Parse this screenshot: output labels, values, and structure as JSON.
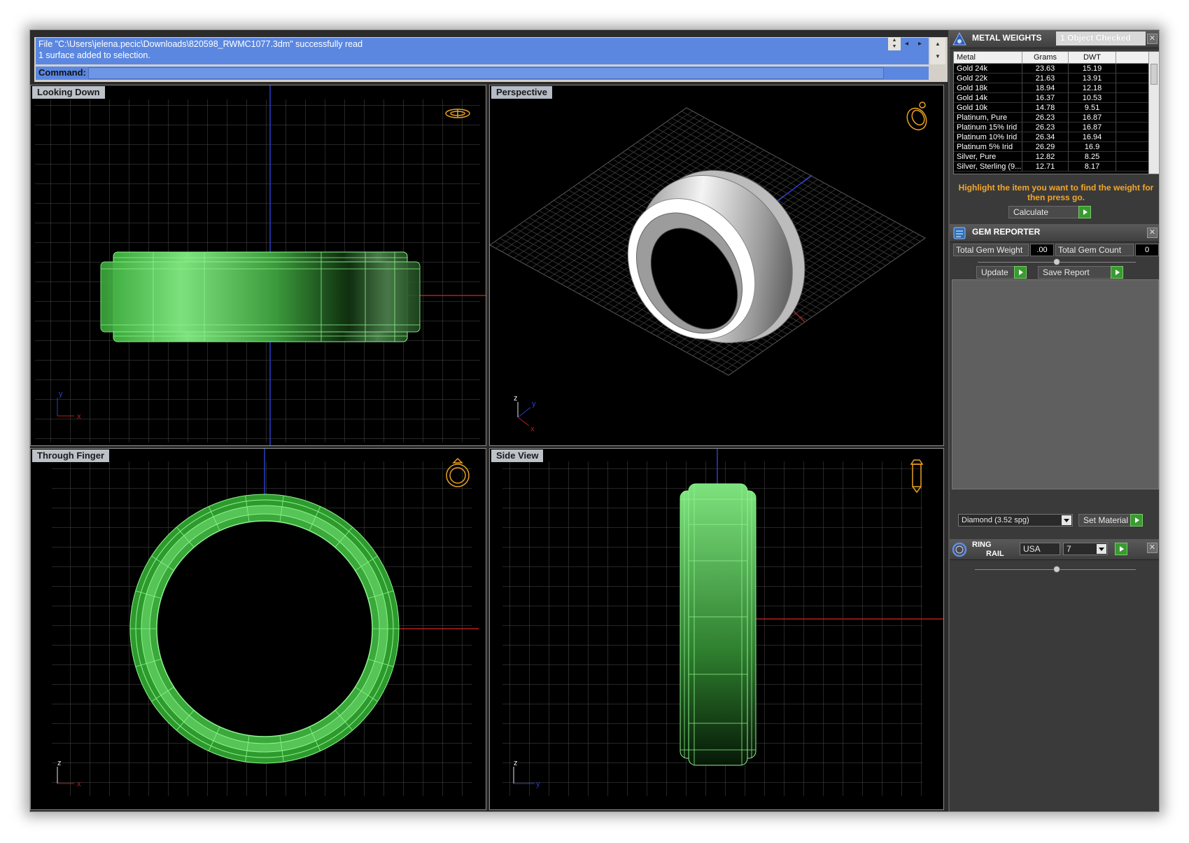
{
  "command": {
    "history_line1": "File \"C:\\Users\\jelena.pecic\\Downloads\\820598_RWMC1077.3dm\" successfully read",
    "history_line2": "1 surface added to selection.",
    "prompt_label": "Command:",
    "input_value": ""
  },
  "viewports": {
    "looking_down": "Looking Down",
    "perspective": "Perspective",
    "through_finger": "Through Finger",
    "side_view": "Side View"
  },
  "axes": {
    "x": "x",
    "y": "y",
    "z": "z"
  },
  "metal_weights": {
    "title": "METAL WEIGHTS",
    "status": "1 Object Checked",
    "columns": [
      "Metal",
      "Grams",
      "DWT"
    ],
    "rows": [
      [
        "Gold 24k",
        "23.63",
        "15.19"
      ],
      [
        "Gold 22k",
        "21.63",
        "13.91"
      ],
      [
        "Gold 18k",
        "18.94",
        "12.18"
      ],
      [
        "Gold 14k",
        "16.37",
        "10.53"
      ],
      [
        "Gold 10k",
        "14.78",
        "9.51"
      ],
      [
        "Platinum, Pure",
        "26.23",
        "16.87"
      ],
      [
        "Platinum 15% Irid",
        "26.23",
        "16.87"
      ],
      [
        "Platinum 10% Irid",
        "26.34",
        "16.94"
      ],
      [
        "Platinum 5% Irid",
        "26.29",
        "16.9"
      ],
      [
        "Silver, Pure",
        "12.82",
        "8.25"
      ],
      [
        "Silver, Sterling (9...",
        "12.71",
        "8.17"
      ]
    ],
    "instructions": "Highlight the item you want to find the weight for then press go.",
    "calculate_label": "Calculate"
  },
  "gem_reporter": {
    "title": "GEM REPORTER",
    "total_weight_label": "Total Gem Weight",
    "total_weight_value": ".00",
    "total_count_label": "Total Gem Count",
    "total_count_value": "0",
    "update_label": "Update",
    "save_report_label": "Save Report",
    "material_value": "Diamond    (3.52 spg)",
    "set_material_label": "Set Material"
  },
  "ring_rail": {
    "title_line1": "RING",
    "title_line2": "RAIL",
    "region_value": "USA",
    "size_value": "7"
  },
  "colors": {
    "command_bg": "#5b87e0",
    "ring_wire": "#7cf07c",
    "instructions_text": "#f3a72c",
    "go_button": "#3a9a32"
  }
}
